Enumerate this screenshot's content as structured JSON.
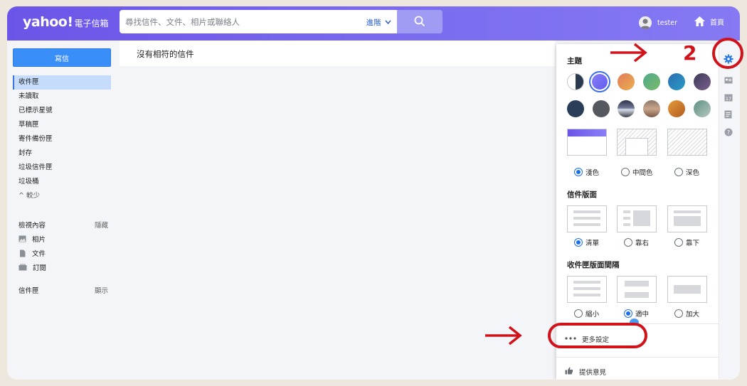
{
  "header": {
    "logo": "yahoo!",
    "service": "電子信箱",
    "search_placeholder": "尋找信件、文件、相片或聯絡人",
    "advanced": "進階",
    "user": "tester",
    "home": "首頁"
  },
  "sidebar": {
    "compose": "寫信",
    "items": [
      {
        "label": "收件匣",
        "active": true
      },
      {
        "label": "未讀取"
      },
      {
        "label": "已標示星號"
      },
      {
        "label": "草稿匣"
      },
      {
        "label": "寄件備份匣"
      },
      {
        "label": "封存"
      },
      {
        "label": "垃圾信件匣"
      },
      {
        "label": "垃圾桶"
      }
    ],
    "less": "^ 較少",
    "views": {
      "title": "檢視內容",
      "toggle": "隱藏"
    },
    "view_items": [
      "相片",
      "文件",
      "訂閱"
    ],
    "folders": {
      "title": "信件匣",
      "toggle": "顯示"
    }
  },
  "main": {
    "empty_title": "沒有相符的信件"
  },
  "settings": {
    "theme_title": "主題",
    "brightness": [
      "淺色",
      "中間色",
      "深色"
    ],
    "brightness_selected": "淺色",
    "layout_title": "信件版面",
    "layouts": [
      "清單",
      "靠右",
      "靠下"
    ],
    "layout_selected": "清單",
    "spacing_title": "收件匣版面間隔",
    "spacing": [
      "縮小",
      "適中",
      "加大"
    ],
    "spacing_selected": "適中",
    "more_settings": "更多設定",
    "feedback": "提供意見"
  },
  "annotations": {
    "step_number": "2",
    "color": "#d0121b"
  },
  "colors": {
    "header_start": "#6b55e8",
    "compose": "#3a8ef8",
    "active_item": "#c5dcfa",
    "radio": "#1b6ee8"
  }
}
